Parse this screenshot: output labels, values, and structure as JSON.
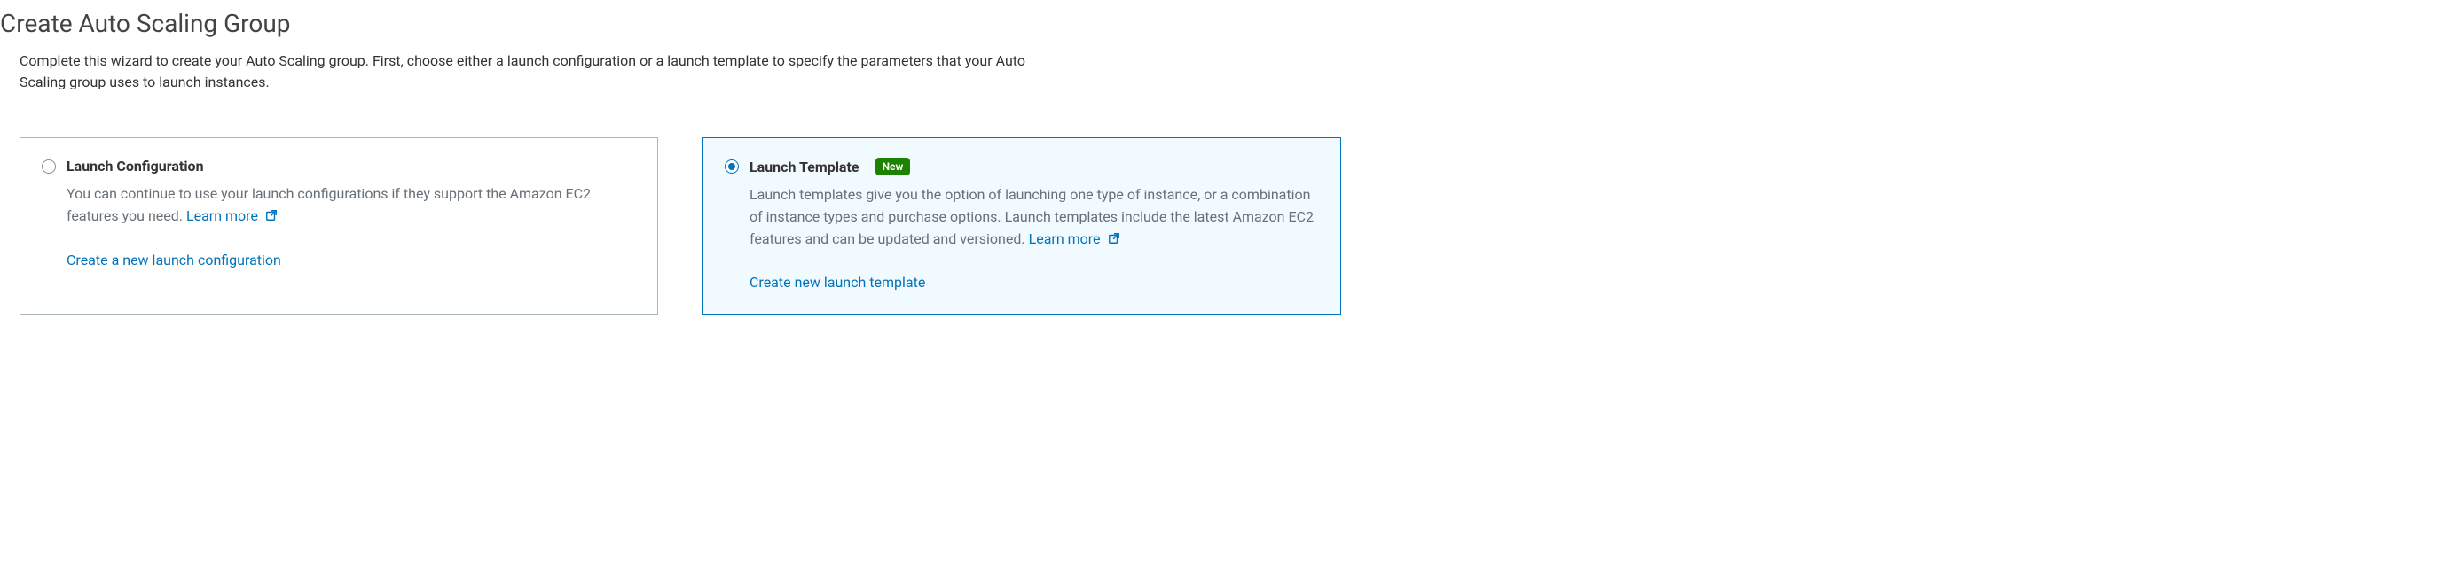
{
  "page": {
    "title": "Create Auto Scaling Group",
    "description": "Complete this wizard to create your Auto Scaling group. First, choose either a launch configuration or a launch template to specify the parameters that your Auto Scaling group uses to launch instances."
  },
  "options": {
    "launchConfig": {
      "title": "Launch Configuration",
      "description": "You can continue to use your launch configurations if they support the Amazon EC2 features you need.",
      "learnMore": "Learn more",
      "actionLink": "Create a new launch configuration",
      "selected": false
    },
    "launchTemplate": {
      "title": "Launch Template",
      "badge": "New",
      "description": "Launch templates give you the option of launching one type of instance, or a combination of instance types and purchase options. Launch templates include the latest Amazon EC2 features and can be updated and versioned.",
      "learnMore": "Learn more",
      "actionLink": "Create new launch template",
      "selected": true
    }
  },
  "colors": {
    "link": "#0073bb",
    "badgeBg": "#1d8102",
    "mutedText": "#687078",
    "selectedCardBg": "#f1faff"
  }
}
